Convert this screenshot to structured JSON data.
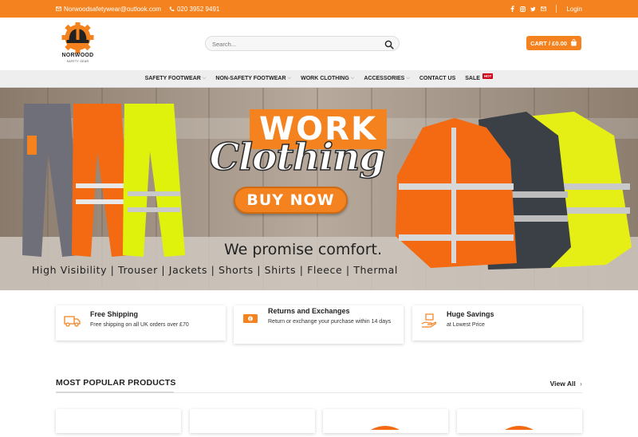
{
  "topbar": {
    "email": "Norwoodsafetywear@outlook.com",
    "phone": "020 3952 9491",
    "social_icons": [
      "facebook-icon",
      "instagram-icon",
      "twitter-icon",
      "email-icon"
    ],
    "login": "Login",
    "bg_color": "#f4821f"
  },
  "header": {
    "logo_name": "NORWOOD",
    "logo_tagline": "SAFETY GEAR",
    "search_placeholder": "Search...",
    "cart_label": "CART / £0.00"
  },
  "nav": {
    "items": [
      {
        "label": "SAFETY FOOTWEAR",
        "dropdown": true
      },
      {
        "label": "NON-SAFETY FOOTWEAR",
        "dropdown": true
      },
      {
        "label": "WORK CLOTHING",
        "dropdown": true
      },
      {
        "label": "ACCESSORIES",
        "dropdown": true
      },
      {
        "label": "CONTACT US",
        "dropdown": false
      },
      {
        "label": "SALE",
        "dropdown": false,
        "badge": "HOT"
      }
    ]
  },
  "hero": {
    "word1": "WORK",
    "word2": "Clothing",
    "cta": "BUY NOW",
    "promise": "We promise comfort.",
    "categories": "High Visibility  |  Trouser  |  Jackets  |  Shorts  |  Shirts  |  Fleece  |  Thermal"
  },
  "features": [
    {
      "icon": "truck-icon",
      "title": "Free Shipping",
      "subtitle": "Free shipping on all UK orders over £70"
    },
    {
      "icon": "money-icon",
      "title": "Returns and Exchanges",
      "subtitle": "Return or exchange your purchase within 14 days"
    },
    {
      "icon": "savings-icon",
      "title": "Huge Savings",
      "subtitle": "at Lowest Price"
    }
  ],
  "popular": {
    "title": "MOST POPULAR PRODUCTS",
    "view_all": "View All"
  },
  "colors": {
    "accent": "#f4821f",
    "hot_badge": "#d0021b"
  }
}
